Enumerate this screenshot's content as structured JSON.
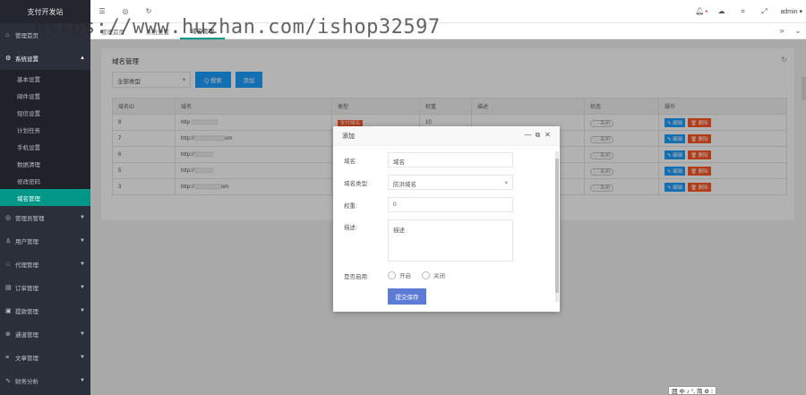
{
  "sidebar": {
    "brand": "支付开发站",
    "items": [
      {
        "label": "管理首页",
        "icon": "home-icon"
      },
      {
        "label": "系统设置",
        "icon": "gear-icon",
        "open": true
      }
    ],
    "submenu": [
      "基本设置",
      "邮件设置",
      "短信设置",
      "计划任务",
      "手机设置",
      "数据清理",
      "修改密码",
      "域名管理"
    ],
    "submenu_active": "域名管理",
    "more": [
      {
        "label": "管理员管理",
        "icon": "users-icon"
      },
      {
        "label": "用户管理",
        "icon": "user-icon"
      },
      {
        "label": "代理管理",
        "icon": "agent-icon"
      },
      {
        "label": "订单管理",
        "icon": "order-icon"
      },
      {
        "label": "提款管理",
        "icon": "withdraw-icon"
      },
      {
        "label": "通道管理",
        "icon": "channel-icon"
      },
      {
        "label": "文章管理",
        "icon": "article-icon"
      },
      {
        "label": "财务分析",
        "icon": "finance-icon"
      }
    ]
  },
  "header": {
    "user": "admin",
    "icons": [
      "menu-toggle-icon",
      "globe-icon",
      "refresh-icon",
      "bell-icon",
      "theme-icon",
      "tag-icon",
      "fullscreen-icon"
    ]
  },
  "watermark": "https://www.huzhan.com/ishop32597",
  "tabs": [
    "管理首页",
    "系统设置",
    "域名管理"
  ],
  "tabs_active": 2,
  "panel": {
    "title": "域名管理",
    "filter_value": "全部类型",
    "search_label": "Q 搜索",
    "add_label": "添加",
    "columns": [
      "域名ID",
      "域名",
      "类型",
      "权重",
      "描述",
      "状态",
      "操作"
    ],
    "rows": [
      {
        "id": "8",
        "domain": "http",
        "type": "支付域名",
        "weight": "10",
        "desc": "",
        "status": "关闭"
      },
      {
        "id": "7",
        "domain": "http://",
        "domain_tail": "om",
        "type": "",
        "weight": "",
        "desc": "",
        "status": "关闭"
      },
      {
        "id": "6",
        "domain": "http://",
        "domain_tail": "",
        "type": "",
        "weight": "",
        "desc": "",
        "status": "关闭"
      },
      {
        "id": "5",
        "domain": "http://",
        "domain_tail": "",
        "type": "",
        "weight": "",
        "desc": "",
        "status": "关闭"
      },
      {
        "id": "3",
        "domain": "http://",
        "domain_tail": "om",
        "type": "",
        "weight": "",
        "desc": "",
        "status": "关闭"
      }
    ],
    "edit_label": "编辑",
    "delete_label": "删除"
  },
  "dialog": {
    "title": "添加",
    "fields": {
      "domain_label": "域名:",
      "domain_value": "域名",
      "type_label": "域名类型:",
      "type_value": "防洪域名",
      "weight_label": "权重:",
      "weight_value": "0",
      "desc_label": "描述:",
      "desc_value": "描述",
      "enable_label": "是否启用:",
      "enable_on": "开启",
      "enable_off": "关闭"
    },
    "submit_label": "提交保存"
  },
  "ime": "囲 中 ♪ °, 简 ⚙ ⁝"
}
